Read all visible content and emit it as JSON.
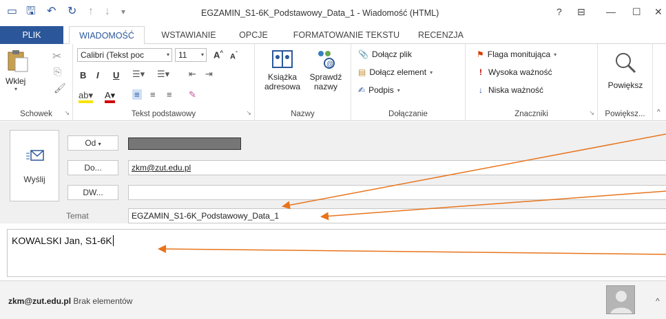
{
  "window": {
    "title": "EGZAMIN_S1-6K_Podstawowy_Data_1 - Wiadomość (HTML)",
    "help": "?",
    "controls": [
      "⊟",
      "—",
      "☐",
      "✕"
    ]
  },
  "tabs": [
    "PLIK",
    "WIADOMOŚĆ",
    "WSTAWIANIE",
    "OPCJE",
    "FORMATOWANIE TEKSTU",
    "RECENZJA"
  ],
  "ribbon": {
    "clipboard": {
      "label": "Schowek",
      "paste": "Wklej"
    },
    "basic_text": {
      "label": "Tekst podstawowy",
      "font": "Calibri (Tekst poc",
      "size": "11"
    },
    "names": {
      "label": "Nazwy",
      "address_book_1": "Książka",
      "address_book_2": "adresowa",
      "check_names_1": "Sprawdź",
      "check_names_2": "nazwy"
    },
    "include": {
      "label": "Dołączanie",
      "attach_file": "Dołącz plik",
      "attach_item": "Dołącz element",
      "signature": "Podpis"
    },
    "tags": {
      "label": "Znaczniki",
      "followup": "Flaga monitująca",
      "high": "Wysoka ważność",
      "low": "Niska ważność"
    },
    "zoom": {
      "label": "Powiększ...",
      "button": "Powiększ"
    }
  },
  "compose": {
    "send": "Wyślij",
    "from_label": "Od",
    "to_label": "Do...",
    "to_value": "zkm@zut.edu.pl",
    "cc_label": "DW...",
    "cc_value": "",
    "subject_label": "Temat",
    "subject_value": "EGZAMIN_S1-6K_Podstawowy_Data_1",
    "body": "KOWALSKI Jan, S1-6K"
  },
  "footer": {
    "email": "zkm@zut.edu.pl",
    "status": "Brak elementów"
  },
  "colors": {
    "accent": "#2b579a",
    "annotation": "#e8731a"
  }
}
